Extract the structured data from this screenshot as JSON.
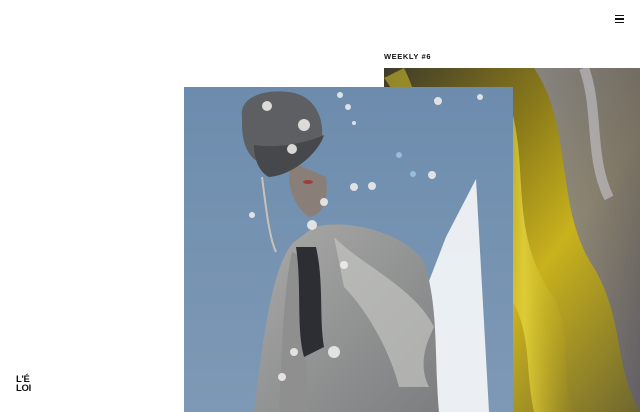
{
  "header": {
    "menu_icon": "hamburger-menu-icon"
  },
  "feature": {
    "label": "WEEKLY #6"
  },
  "brand": {
    "logo_line1": "L'É",
    "logo_line2": "LOI"
  },
  "colors": {
    "background": "#ffffff",
    "text": "#111111",
    "fabric_yellow": "#c9b21c",
    "sky_blue": "#6f8fb0"
  }
}
